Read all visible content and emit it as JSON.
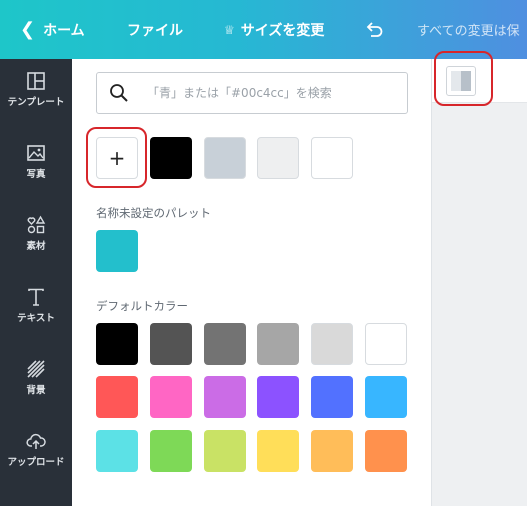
{
  "topbar": {
    "back_label": "ホーム",
    "file_label": "ファイル",
    "resize_label": "サイズを変更",
    "saved_status": "すべての変更は保"
  },
  "rail": {
    "items": [
      {
        "label": "テンプレート",
        "icon": "template-icon"
      },
      {
        "label": "写真",
        "icon": "photo-icon"
      },
      {
        "label": "素材",
        "icon": "elements-icon"
      },
      {
        "label": "テキスト",
        "icon": "text-icon"
      },
      {
        "label": "背景",
        "icon": "background-icon"
      },
      {
        "label": "アップロード",
        "icon": "upload-icon"
      }
    ]
  },
  "search": {
    "placeholder": "「青」または「#00c4cc」を検索",
    "value": ""
  },
  "document_colors": {
    "add_label": "+",
    "swatches": [
      "#000000",
      "#c8d0d8",
      "#eeeff0",
      "#ffffff"
    ]
  },
  "palette": {
    "title": "名称未設定のパレット",
    "swatches": [
      "#23bfcc"
    ]
  },
  "default_colors": {
    "title": "デフォルトカラー",
    "rows": [
      [
        "#000000",
        "#545454",
        "#737373",
        "#a6a6a6",
        "#d9d9d9",
        "#ffffff"
      ],
      [
        "#ff5757",
        "#ff66c4",
        "#cb6ce6",
        "#8c52ff",
        "#5271ff",
        "#38b6ff"
      ],
      [
        "#5ce1e6",
        "#7ed957",
        "#c9e265",
        "#ffde59",
        "#ffbd59",
        "#ff914d"
      ]
    ]
  },
  "colors": {
    "accent_red": "#d7262b",
    "rail_bg": "#293039",
    "topbar_start": "#1ec6c9",
    "topbar_end": "#4f8fe0"
  }
}
